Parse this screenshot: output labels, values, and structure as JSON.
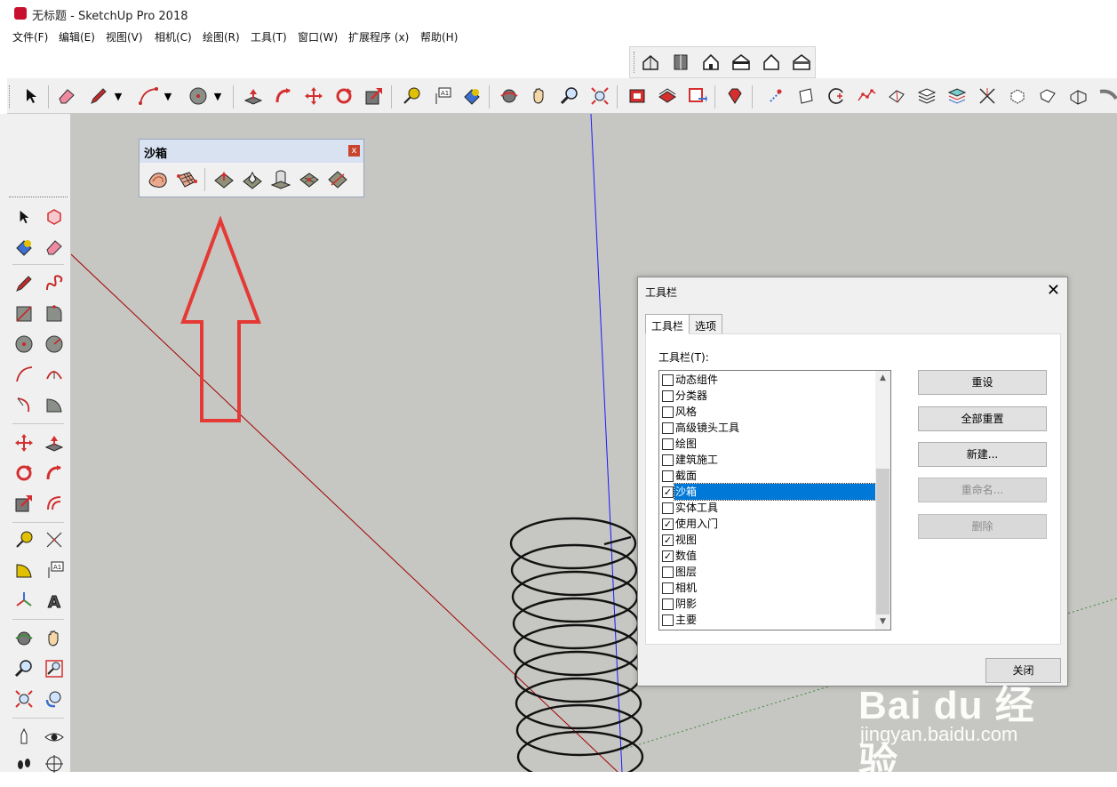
{
  "window": {
    "title": "无标题 - SketchUp Pro 2018"
  },
  "menu": [
    "文件(F)",
    "编辑(E)",
    "视图(V)",
    "相机(C)",
    "绘图(R)",
    "工具(T)",
    "窗口(W)",
    "扩展程序 (x)",
    "帮助(H)"
  ],
  "toolbar_views": [
    "iso-view-icon",
    "top-view-icon",
    "front-view-icon",
    "right-view-icon",
    "back-view-icon",
    "left-view-icon"
  ],
  "toolbar_main": [
    "select-icon",
    "eraser-icon",
    "pencil-icon",
    "arc-icon",
    "circle-icon",
    "push-pull-icon",
    "follow-me-icon",
    "move-icon",
    "rotate-icon",
    "scale-icon",
    "tape-measure-icon",
    "text-icon",
    "paint-bucket-icon",
    "orbit-icon",
    "pan-icon",
    "zoom-icon",
    "zoom-extents-icon",
    "warehouse-icon",
    "extension-warehouse-icon",
    "layout-icon",
    "ruby-icon"
  ],
  "sandbox_toolbar": {
    "title": "沙箱",
    "close": "x",
    "icons": [
      "sandbox-from-contours-icon",
      "sandbox-from-scratch-icon",
      "smoove-icon",
      "stamp-icon",
      "drape-icon",
      "add-detail-icon",
      "flip-edge-icon"
    ]
  },
  "dialog": {
    "title": "工具栏",
    "close": "✕",
    "tabs": [
      "工具栏",
      "选项"
    ],
    "list_label": "工具栏(T):",
    "items": [
      {
        "label": "动态组件",
        "checked": false
      },
      {
        "label": "分类器",
        "checked": false
      },
      {
        "label": "风格",
        "checked": false
      },
      {
        "label": "高级镜头工具",
        "checked": false
      },
      {
        "label": "绘图",
        "checked": false
      },
      {
        "label": "建筑施工",
        "checked": false
      },
      {
        "label": "截面",
        "checked": false
      },
      {
        "label": "沙箱",
        "checked": true,
        "selected": true
      },
      {
        "label": "实体工具",
        "checked": false
      },
      {
        "label": "使用入门",
        "checked": true
      },
      {
        "label": "视图",
        "checked": true
      },
      {
        "label": "数值",
        "checked": true
      },
      {
        "label": "图层",
        "checked": false
      },
      {
        "label": "相机",
        "checked": false
      },
      {
        "label": "阴影",
        "checked": false
      },
      {
        "label": "主要",
        "checked": false
      }
    ],
    "buttons": {
      "reset": "重设",
      "reset_all": "全部重置",
      "new": "新建...",
      "rename": "重命名...",
      "delete": "删除",
      "close": "关闭"
    }
  },
  "watermark": {
    "brand": "Bai du 经验",
    "site": "jingyan.baidu.com"
  },
  "colors": {
    "viewport": "#c6c6c2",
    "selection": "#0078d7",
    "annotation_arrow": "#e53935",
    "axis_red": "#a00000",
    "axis_blue": "#1a1aff"
  }
}
